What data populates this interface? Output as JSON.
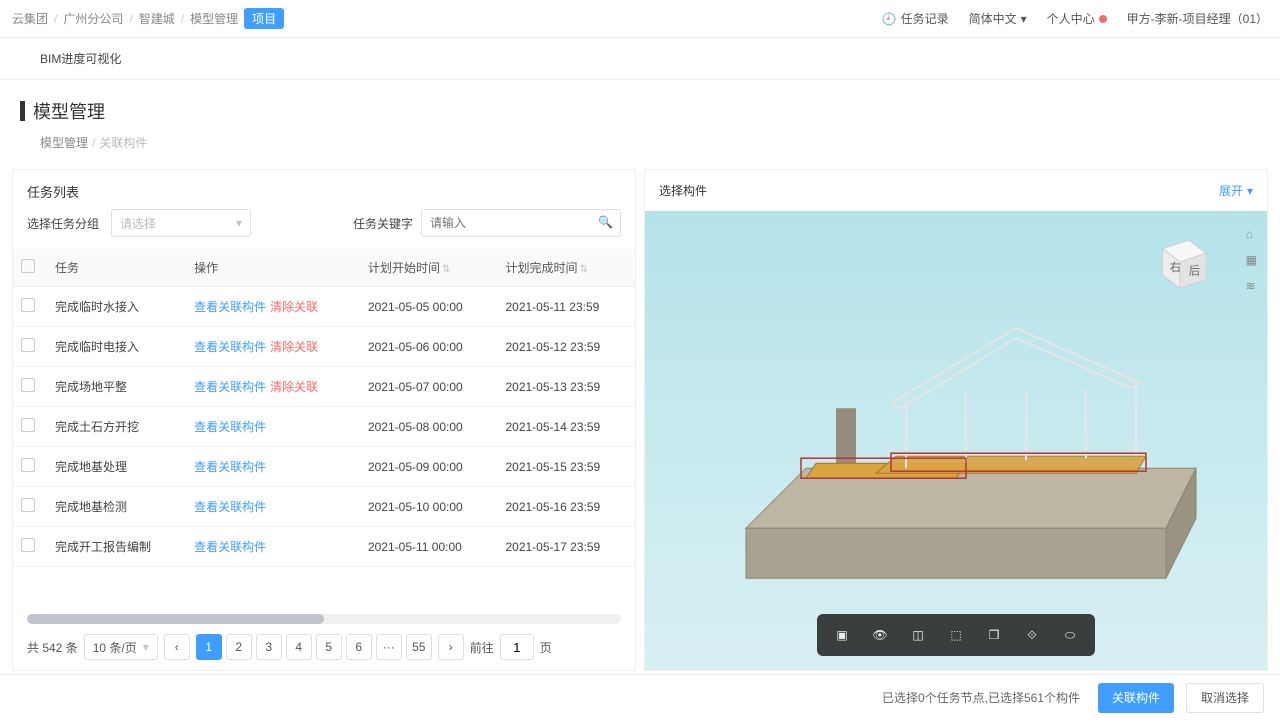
{
  "topbar": {
    "crumbs": [
      "云集团",
      "广州分公司",
      "智建城",
      "模型管理",
      "项目"
    ],
    "task_log": "任务记录",
    "lang": "简体中文",
    "center": "个人中心",
    "user": "甲方-李新-项目经理（01）"
  },
  "subheader": {
    "text": "BIM进度可视化"
  },
  "page": {
    "title": "模型管理",
    "crumbs": [
      "模型管理",
      "关联构件"
    ]
  },
  "left": {
    "title": "任务列表",
    "filter_group_label": "选择任务分组",
    "select_placeholder": "请选择",
    "keyword_label": "任务关键字",
    "keyword_placeholder": "请输入",
    "cols": {
      "task": "任务",
      "op": "操作",
      "start": "计划开始时间",
      "end": "计划完成时间"
    },
    "ops": {
      "view": "查看关联构件",
      "clear": "清除关联"
    },
    "rows": [
      {
        "task": "完成临时水接入",
        "clear": true,
        "start": "2021-05-05 00:00",
        "end": "2021-05-11 23:59"
      },
      {
        "task": "完成临时电接入",
        "clear": true,
        "start": "2021-05-06 00:00",
        "end": "2021-05-12 23:59"
      },
      {
        "task": "完成场地平整",
        "clear": true,
        "start": "2021-05-07 00:00",
        "end": "2021-05-13 23:59"
      },
      {
        "task": "完成土石方开挖",
        "clear": false,
        "start": "2021-05-08 00:00",
        "end": "2021-05-14 23:59"
      },
      {
        "task": "完成地基处理",
        "clear": false,
        "start": "2021-05-09 00:00",
        "end": "2021-05-15 23:59"
      },
      {
        "task": "完成地基检测",
        "clear": false,
        "start": "2021-05-10 00:00",
        "end": "2021-05-16 23:59"
      },
      {
        "task": "完成开工报告编制",
        "clear": false,
        "start": "2021-05-11 00:00",
        "end": "2021-05-17 23:59"
      }
    ]
  },
  "pager": {
    "total_label": "共 542 条",
    "per_page": "10 条/页",
    "pages": [
      "1",
      "2",
      "3",
      "4",
      "5",
      "6",
      "···",
      "55"
    ],
    "active": "1",
    "goto": "前往",
    "goto_value": "1",
    "page_suffix": "页"
  },
  "right": {
    "title": "选择构件",
    "expand": "展开",
    "cube": {
      "right": "右",
      "back": "后"
    }
  },
  "footer": {
    "status": "已选择0个任务节点,已选择561个构件",
    "primary": "关联构件",
    "default": "取消选择"
  }
}
